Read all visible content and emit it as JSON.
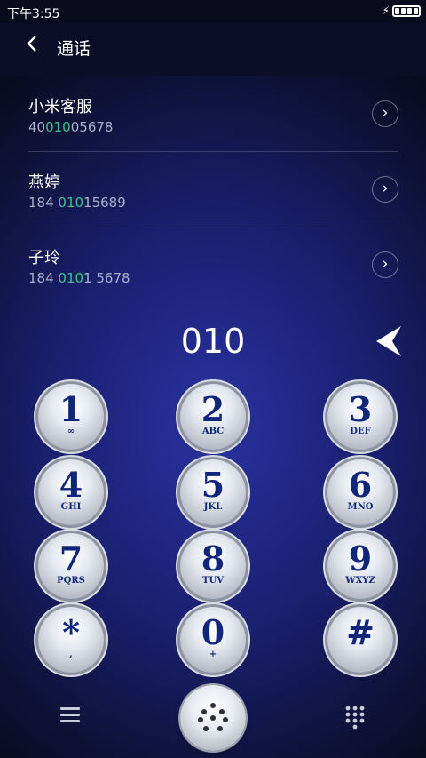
{
  "status": {
    "time": "下午3:55"
  },
  "header": {
    "title": "通话"
  },
  "contacts": [
    {
      "name": "小米客服",
      "num_pre": "40",
      "num_hl": "010",
      "num_post": "05678"
    },
    {
      "name": "燕婷",
      "num_pre": "184 ",
      "num_hl": "010",
      "num_post": "15689"
    },
    {
      "name": "子玲",
      "num_pre": "184 ",
      "num_hl": "010",
      "num_post": "1 5678"
    }
  ],
  "dialer": {
    "display": "010",
    "keys": [
      {
        "digit": "1",
        "letters": "∞"
      },
      {
        "digit": "2",
        "letters": "ABC"
      },
      {
        "digit": "3",
        "letters": "DEF"
      },
      {
        "digit": "4",
        "letters": "GHI"
      },
      {
        "digit": "5",
        "letters": "JKL"
      },
      {
        "digit": "6",
        "letters": "MNO"
      },
      {
        "digit": "7",
        "letters": "PQRS"
      },
      {
        "digit": "8",
        "letters": "TUV"
      },
      {
        "digit": "9",
        "letters": "WXYZ"
      },
      {
        "digit": "*",
        "letters": ","
      },
      {
        "digit": "0",
        "letters": "+"
      },
      {
        "digit": "#",
        "letters": ""
      }
    ]
  },
  "colors": {
    "highlight": "#3fc38d",
    "key_text": "#10267a"
  }
}
